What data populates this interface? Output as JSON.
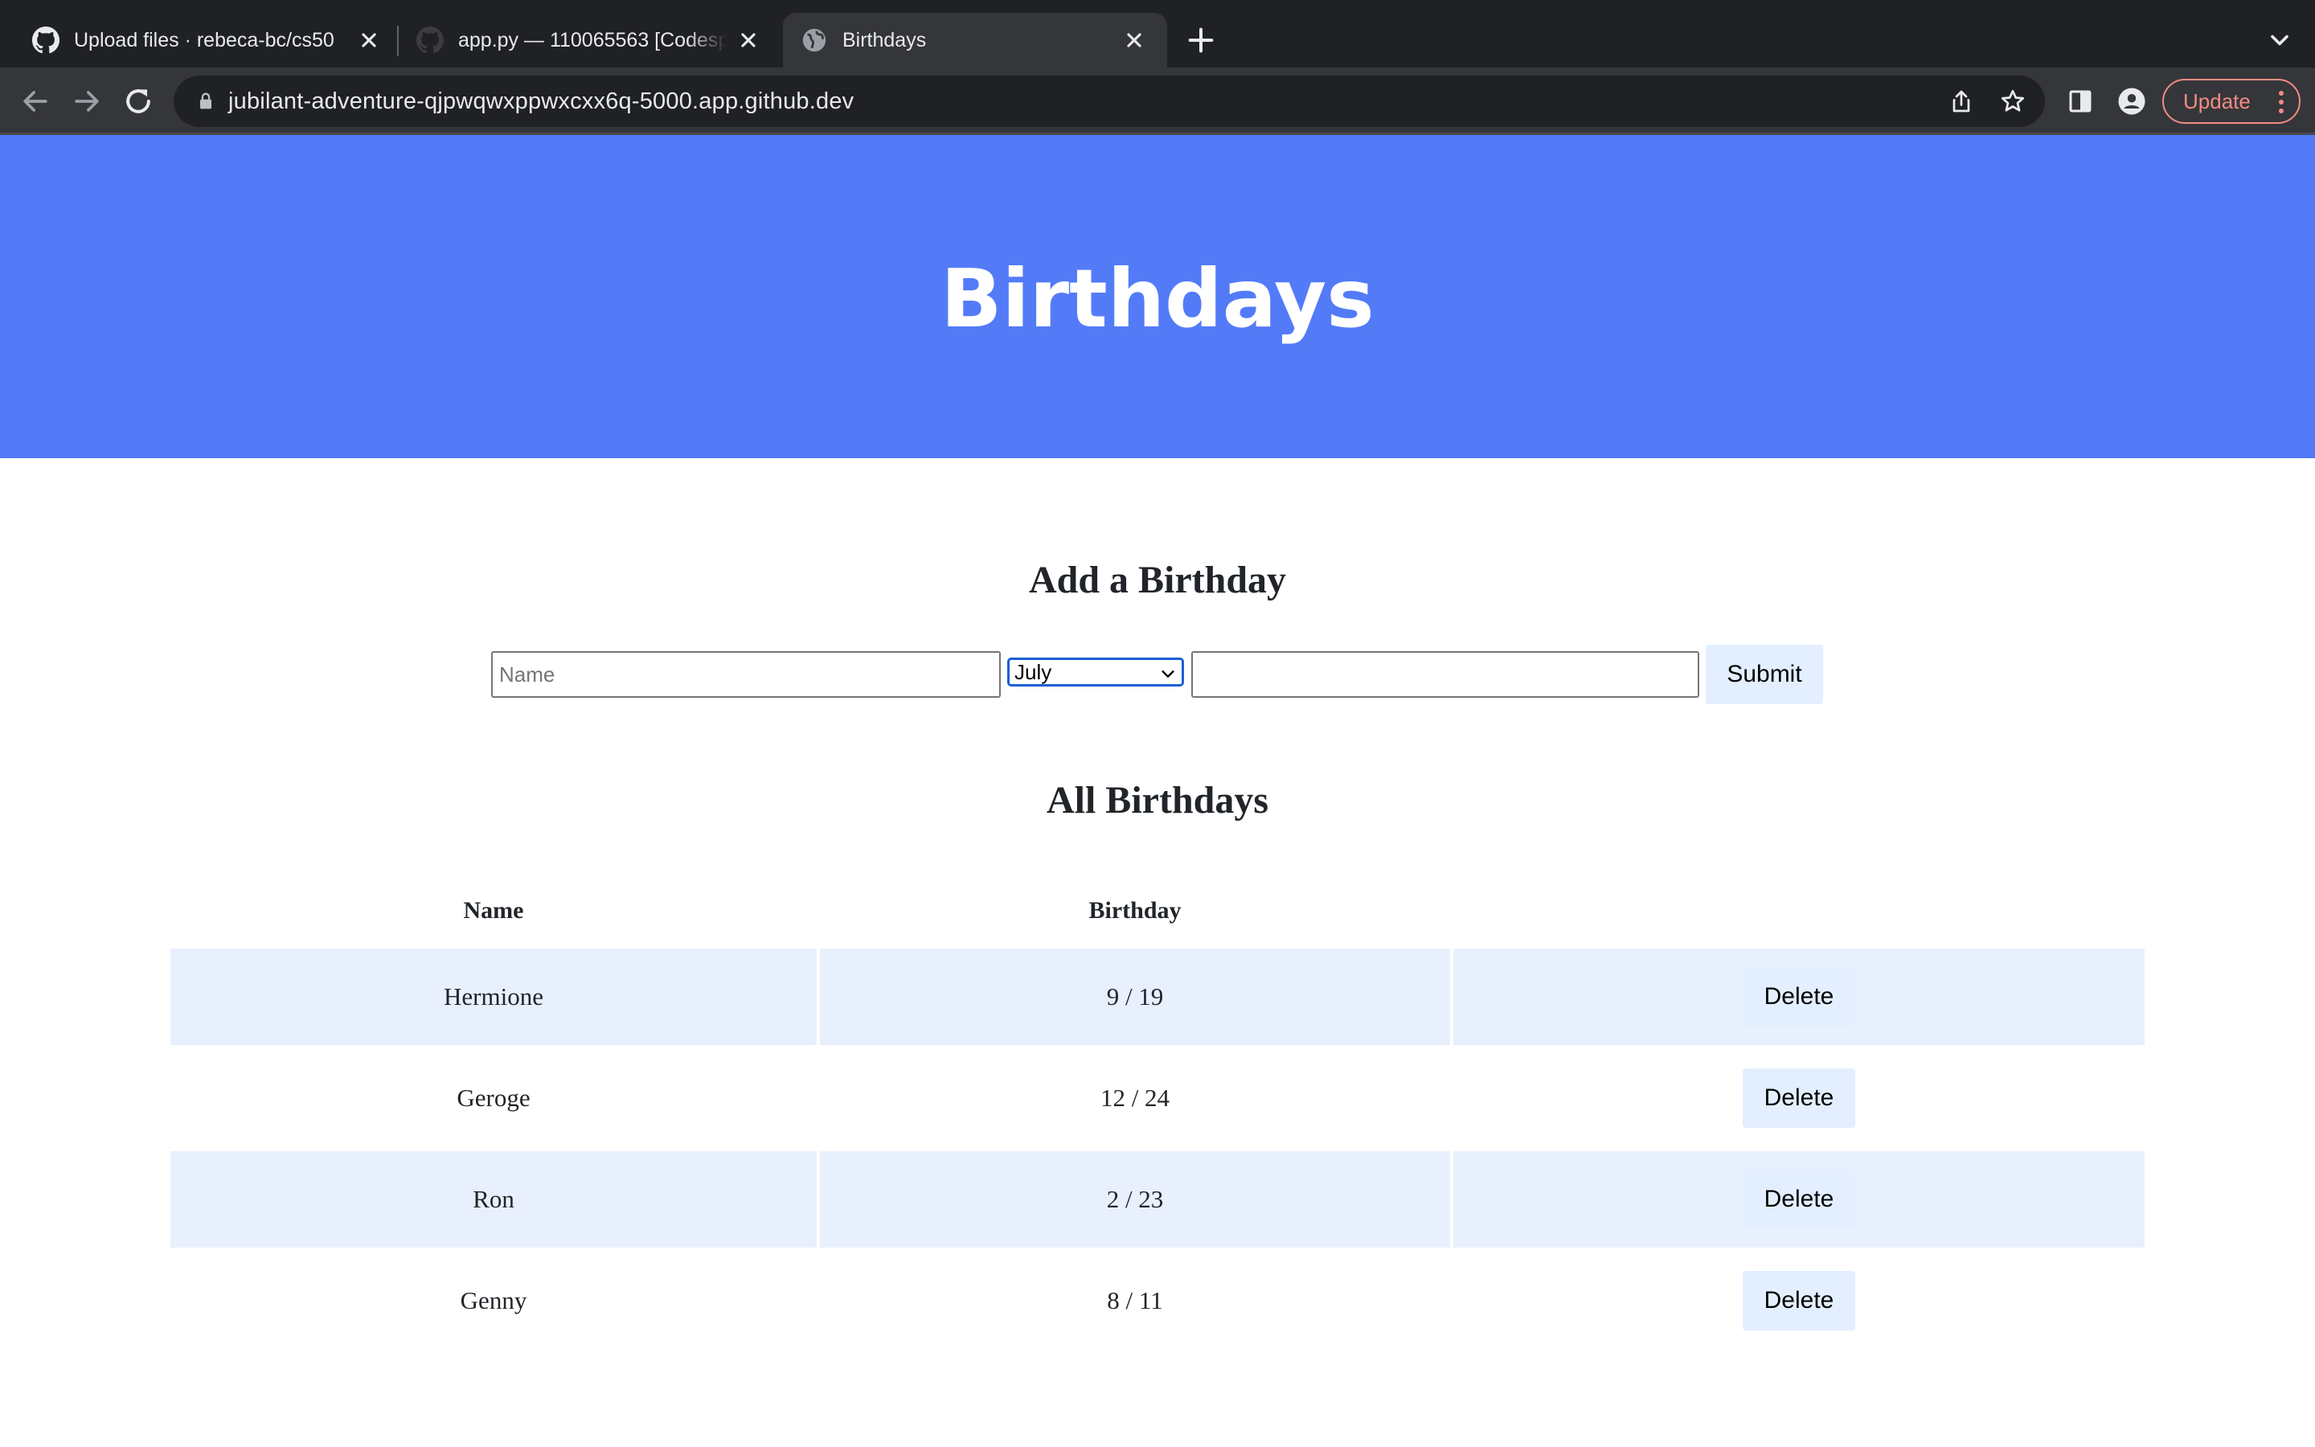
{
  "browser": {
    "tabs": [
      {
        "title": "Upload files · rebeca-bc/cs50",
        "icon": "github-icon",
        "active": false
      },
      {
        "title": "app.py — 110065563 [Codespaces]",
        "icon": "github-icon",
        "active": false
      },
      {
        "title": "Birthdays",
        "icon": "globe-icon",
        "active": true
      }
    ],
    "url": "jubilant-adventure-qjpwqwxppwxcxx6q-5000.app.github.dev",
    "update_label": "Update"
  },
  "page": {
    "header_title": "Birthdays",
    "add_section_title": "Add a Birthday",
    "form": {
      "name_placeholder": "Name",
      "month_selected": "July",
      "day_value": "",
      "submit_label": "Submit"
    },
    "list_section_title": "All Birthdays",
    "table": {
      "columns": [
        "Name",
        "Birthday",
        ""
      ],
      "rows": [
        {
          "name": "Hermione",
          "birthday": "9 / 19",
          "action": "Delete"
        },
        {
          "name": "Geroge",
          "birthday": "12 / 24",
          "action": "Delete"
        },
        {
          "name": "Ron",
          "birthday": "2 / 23",
          "action": "Delete"
        },
        {
          "name": "Genny",
          "birthday": "8 / 11",
          "action": "Delete"
        }
      ]
    }
  },
  "colors": {
    "header_bg": "#537bf8",
    "row_alt_bg": "#e8f0fe",
    "button_bg": "#e3efff",
    "chrome_dark": "#202124",
    "chrome_toolbar": "#35363a",
    "update_accent": "#f28b82"
  }
}
